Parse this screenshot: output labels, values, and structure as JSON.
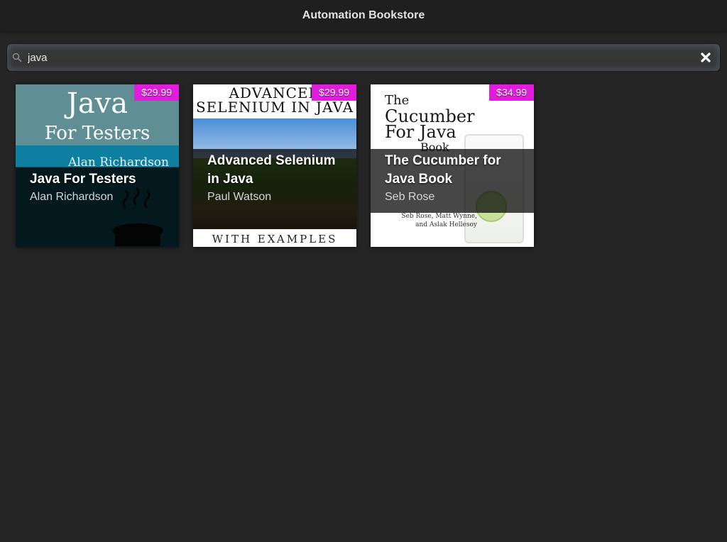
{
  "app": {
    "title": "Automation Bookstore"
  },
  "search": {
    "value": "java",
    "search_icon": "search-icon",
    "clear_icon": "close-icon"
  },
  "books": [
    {
      "title": "Java For Testers",
      "author": "Alan Richardson",
      "price": "$29.99",
      "cover": {
        "line1": "Java",
        "line2": "For Testers",
        "line3": "Alan Richardson"
      }
    },
    {
      "title": "Advanced Selenium in Java",
      "author": "Paul Watson",
      "price": "$29.99",
      "cover": {
        "line1": "ADVANCED",
        "line2": "SELENIUM IN JAVA",
        "line3": "WITH EXAMPLES"
      }
    },
    {
      "title": "The Cucumber for Java Book",
      "author": "Seb Rose",
      "price": "$34.99",
      "cover": {
        "line1": "The",
        "line2": "Cucumber",
        "line3": "For Java",
        "line4": "Book",
        "credits": "Seb Rose, Matt Wynne, and Aslak Hellesoy"
      }
    }
  ],
  "colors": {
    "background": "#252525",
    "header": "#1f1f1f",
    "price_badge": "#e11cdd"
  }
}
